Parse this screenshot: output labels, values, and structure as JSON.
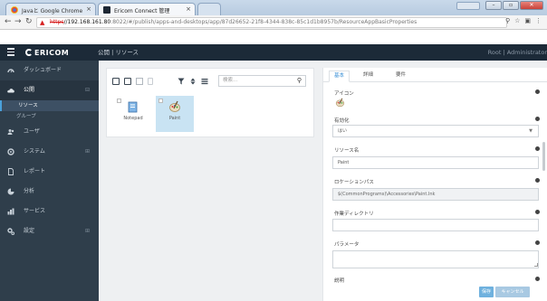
{
  "browser": {
    "tabs": [
      {
        "label": "Javaと Google Chrome"
      },
      {
        "label": "Ericom Connect 管理"
      }
    ],
    "url": {
      "scheme": "https",
      "host": "//192.168.161.80",
      "rest": ":8022/#/publish/apps-and-desktops/app/87d26652-21f8-4344-838c-85c1d1b8957b/ResourceAppBasicProperties"
    },
    "close_symbol": "×"
  },
  "app": {
    "logo_text": "ERICOM",
    "breadcrumb": "公開 | リソース",
    "user": "Root | Administrator"
  },
  "sidebar": {
    "items": [
      {
        "label": "ダッシュボード",
        "icon": "dashboard-icon"
      },
      {
        "label": "公開",
        "icon": "cloud-icon"
      },
      {
        "label": "ユーザ",
        "icon": "users-icon"
      },
      {
        "label": "システム",
        "icon": "system-icon"
      },
      {
        "label": "レポート",
        "icon": "report-icon"
      },
      {
        "label": "分析",
        "icon": "analytics-icon"
      },
      {
        "label": "サービス",
        "icon": "services-icon"
      },
      {
        "label": "設定",
        "icon": "settings-icon"
      }
    ],
    "subitems": [
      {
        "label": "リソース"
      },
      {
        "label": "グループ"
      }
    ]
  },
  "left_panel": {
    "search_placeholder": "検索...",
    "apps": [
      {
        "label": "Notepad"
      },
      {
        "label": "Paint"
      }
    ]
  },
  "right_panel": {
    "tabs": [
      {
        "label": "基本"
      },
      {
        "label": "詳細"
      },
      {
        "label": "要件"
      }
    ],
    "fields": {
      "icon_label": "アイコン",
      "enabled_label": "有効化",
      "enabled_value": "はい",
      "name_label": "リソース名",
      "name_value": "Paint",
      "location_label": "ロケーションパス",
      "location_value": "$(CommonPrograms)\\Accessories\\Paint.lnk",
      "workdir_label": "作業ディレクトリ",
      "workdir_value": "",
      "params_label": "パラメータ",
      "desc_label": "説明"
    },
    "buttons": {
      "save": "保存",
      "cancel": "キャンセル"
    }
  },
  "colors": {
    "nav": "#1c2a38",
    "sidebar": "#2f3e4b",
    "accent": "#3a8fd6",
    "selected": "#c9e3f3"
  }
}
